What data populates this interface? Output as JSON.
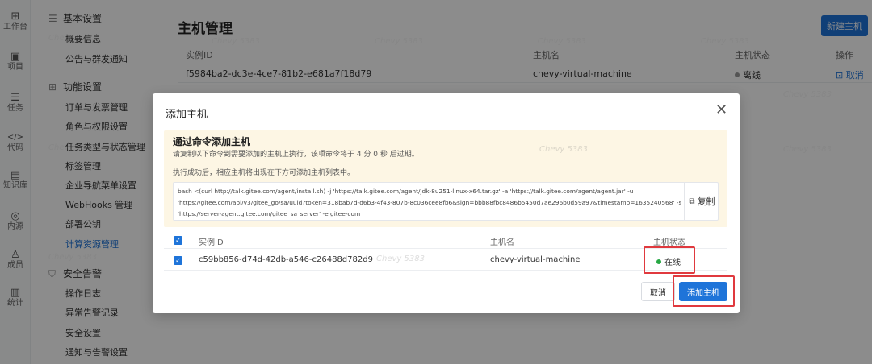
{
  "rail": [
    {
      "icon": "grid-icon",
      "glyph": "⊞",
      "label": "工作台"
    },
    {
      "icon": "project-icon",
      "glyph": "▣",
      "label": "项目"
    },
    {
      "icon": "task-icon",
      "glyph": "☰",
      "label": "任务"
    },
    {
      "icon": "code-icon",
      "glyph": "</>",
      "label": "代码"
    },
    {
      "icon": "knowledge-icon",
      "glyph": "▤",
      "label": "知识库"
    },
    {
      "icon": "source-icon",
      "glyph": "◎",
      "label": "内源"
    },
    {
      "icon": "member-icon",
      "glyph": "♙",
      "label": "成员"
    },
    {
      "icon": "stats-icon",
      "glyph": "▥",
      "label": "统计"
    }
  ],
  "menu": {
    "group_basic": "基本设置",
    "overview": "概要信息",
    "notice": "公告与群发通知",
    "group_feature": "功能设置",
    "order": "订单与发票管理",
    "roles": "角色与权限设置",
    "task_types": "任务类型与状态管理",
    "labels": "标签管理",
    "nav_menu": "企业导航菜单设置",
    "webhooks": "WebHooks 管理",
    "deploy": "部署公钥",
    "compute": "计算资源管理",
    "group_security": "安全告警",
    "oplog": "操作日志",
    "alerts": "异常告警记录",
    "sec_settings": "安全设置",
    "notify": "通知与告警设置"
  },
  "main": {
    "title": "主机管理",
    "new_host": "新建主机",
    "columns": {
      "id": "实例ID",
      "name": "主机名",
      "status": "主机状态",
      "ops": "操作"
    },
    "row": {
      "id": "f5984ba2-dc3e-4ce7-81b2-e681a7f18d79",
      "name": "chevy-virtual-machine",
      "status": "离线",
      "op": "取消"
    }
  },
  "modal": {
    "title": "添加主机",
    "tip_title": "通过命令添加主机",
    "tip_desc1": "请复制以下命令到需要添加的主机上执行，该项命令将于 4 分 0 秒 后过期。",
    "tip_desc2": "执行成功后，相应主机将出现在下方可添加主机列表中。",
    "command": [
      "bash <(curl http://talk.gitee.com/agent/install.sh) -j 'https://talk.gitee.com/agent/jdk-8u251-linux-x64.tar.gz' -a 'https://talk.gitee.com/agent/agent.jar' -u",
      "'https://gitee.com/api/v3/gitee_go/sa/uuid?token=318bab7d-d6b3-4f43-807b-8c036cee8fb6&sign=bbb88fbc8486b5450d7ae296b0d59a97&timestamp=1635240568' -s",
      "'https://server-agent.gitee.com/gitee_sa_server' -e gitee-com"
    ],
    "copy": "复制",
    "table": {
      "col_id": "实例ID",
      "col_name": "主机名",
      "col_status": "主机状态",
      "row": {
        "id": "c59bb856-d74d-42db-a546-c26488d782d9",
        "name": "chevy-virtual-machine",
        "status": "在线"
      }
    },
    "cancel": "取消",
    "add": "添加主机"
  },
  "watermark": "Chevy 5383",
  "colors": {
    "accent": "#1e74d9",
    "online": "#27a844",
    "highlight": "#e0393e",
    "tip_bg": "#fdf6e4"
  }
}
